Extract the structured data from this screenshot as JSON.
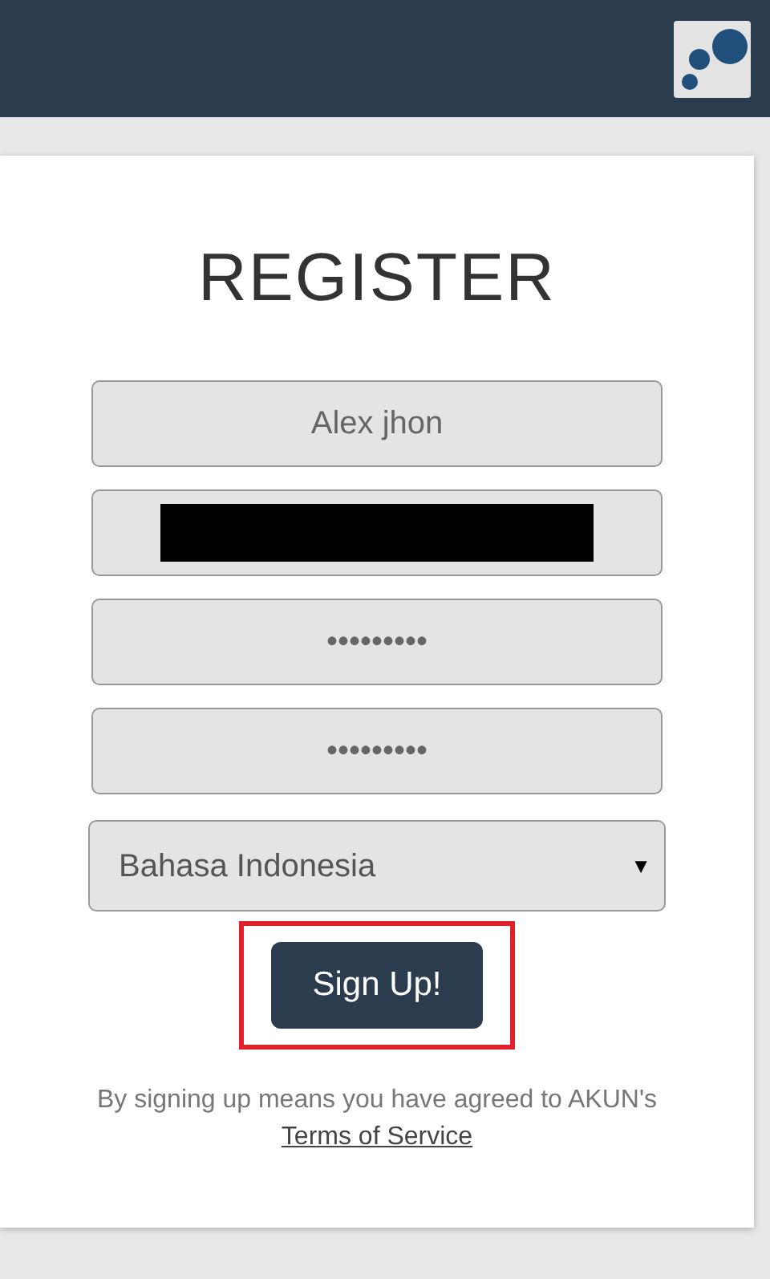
{
  "title": "REGISTER",
  "fields": [
    {
      "kind": "text",
      "value": "Alex jhon"
    },
    {
      "kind": "redacted"
    },
    {
      "kind": "password",
      "value": "•••••••••"
    },
    {
      "kind": "password",
      "value": "•••••••••"
    }
  ],
  "language_select": {
    "value": "Bahasa Indonesia",
    "arrow": "▼"
  },
  "signup_button": {
    "label": "Sign Up!",
    "highlighted": true
  },
  "notice": {
    "text": "By signing up means you have agreed to AKUN's",
    "link": "Terms of Service"
  }
}
